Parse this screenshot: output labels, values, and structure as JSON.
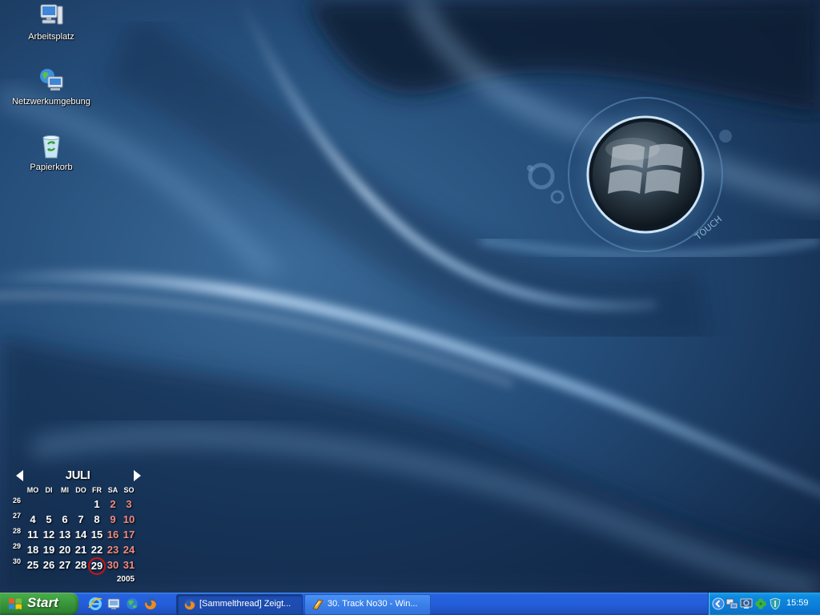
{
  "desktop": {
    "icons": [
      {
        "label": "Arbeitsplatz",
        "icon": "my-computer-icon"
      },
      {
        "label": "Netzwerkumgebung",
        "icon": "network-places-icon"
      },
      {
        "label": "Papierkorb",
        "icon": "recycle-bin-icon"
      }
    ],
    "wallpaper_logo_text": "TOUCH"
  },
  "calendar": {
    "month": "JULI",
    "year": "2005",
    "weekdays": [
      "MO",
      "DI",
      "MI",
      "DO",
      "FR",
      "SA",
      "SO"
    ],
    "weeks": [
      {
        "week": "26",
        "days": [
          "",
          "",
          "",
          "",
          "1",
          "2",
          "3"
        ]
      },
      {
        "week": "27",
        "days": [
          "4",
          "5",
          "6",
          "7",
          "8",
          "9",
          "10"
        ]
      },
      {
        "week": "28",
        "days": [
          "11",
          "12",
          "13",
          "14",
          "15",
          "16",
          "17"
        ]
      },
      {
        "week": "29",
        "days": [
          "18",
          "19",
          "20",
          "21",
          "22",
          "23",
          "24"
        ]
      },
      {
        "week": "30",
        "days": [
          "25",
          "26",
          "27",
          "28",
          "29",
          "30",
          "31"
        ]
      }
    ],
    "today": "29",
    "weekend_color": "#f08a80",
    "today_marker_color": "#d01414"
  },
  "taskbar": {
    "start_label": "Start",
    "quick_launch": [
      {
        "icon": "internet-explorer-icon"
      },
      {
        "icon": "show-desktop-icon"
      },
      {
        "icon": "globe-icon"
      },
      {
        "icon": "firefox-icon"
      }
    ],
    "tasks": [
      {
        "label": "[Sammelthread] Zeigt...",
        "icon": "firefox-icon",
        "active": true
      },
      {
        "label": "30. Track No30 - Win...",
        "icon": "winamp-icon",
        "active": false
      }
    ],
    "tray": {
      "icons": [
        "show-hidden-icon",
        "network-icon",
        "monitor-icon",
        "clover-icon",
        "shield-icon"
      ],
      "time": "15:59"
    },
    "colors": {
      "taskbar": "#245edb",
      "start": "#3c9b3e",
      "tray": "#0b7ed8"
    }
  }
}
